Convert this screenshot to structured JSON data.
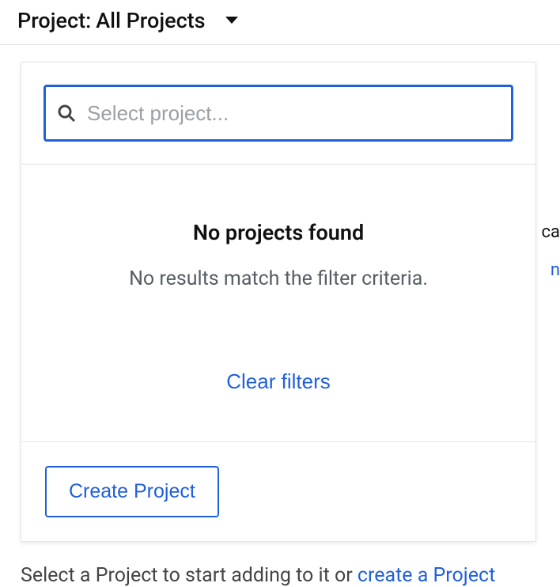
{
  "header": {
    "label_prefix": "Project:",
    "label_value": "All Projects"
  },
  "search": {
    "placeholder": "Select project..."
  },
  "empty_state": {
    "title": "No projects found",
    "subtitle": "No results match the filter criteria.",
    "clear_filters_label": "Clear filters"
  },
  "footer": {
    "create_button_label": "Create Project"
  },
  "bottom_hint": {
    "text_before": "Select a Project to start adding to it or ",
    "link_text": "create a Project"
  },
  "bg_fragments": {
    "line1": "ca",
    "line2": "n"
  }
}
